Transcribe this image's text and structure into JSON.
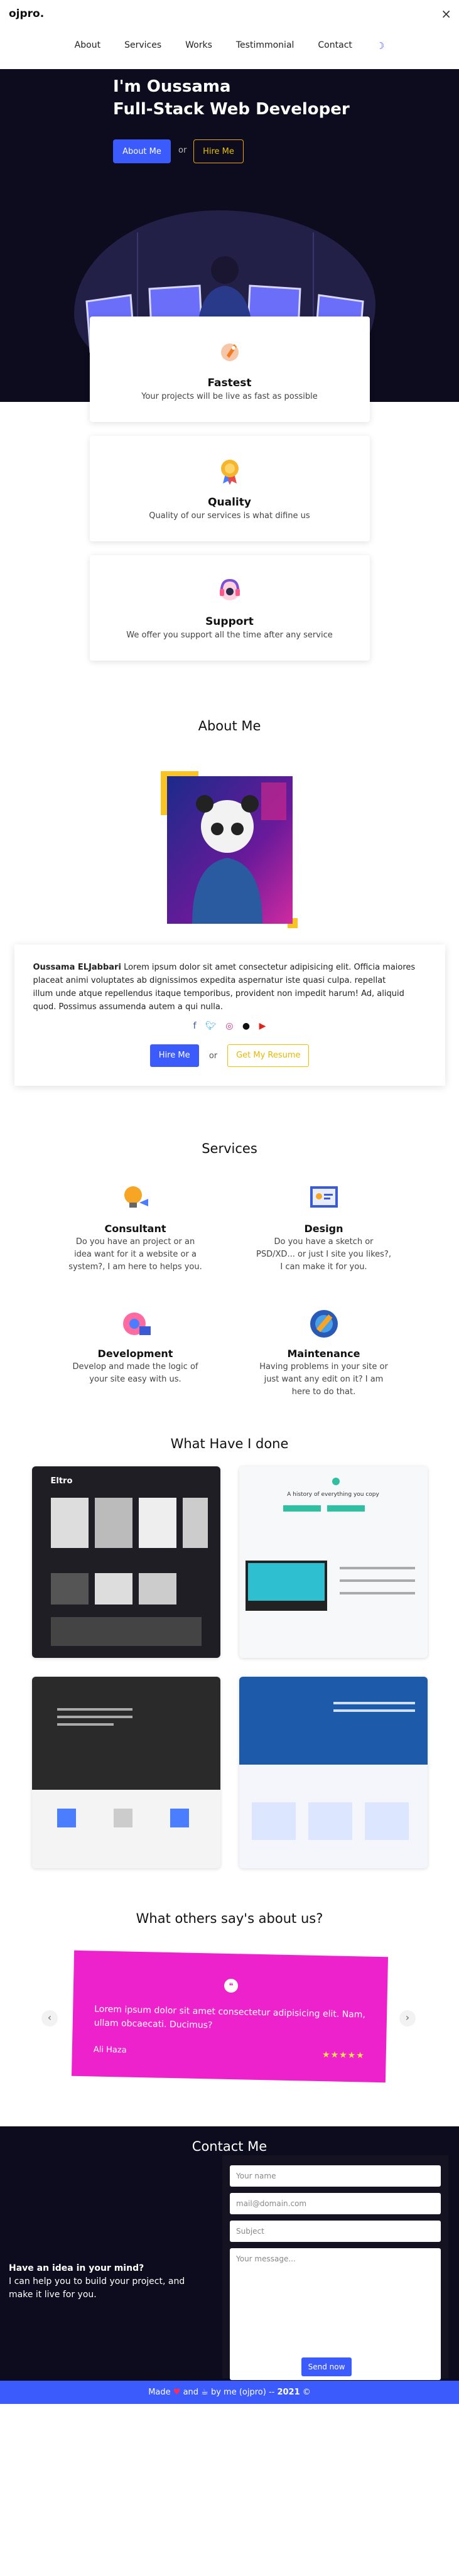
{
  "nav": {
    "logo": "ojpro.",
    "close_icon": "×",
    "items": [
      "About",
      "Services",
      "Works",
      "Testimmonial",
      "Contact"
    ],
    "theme_toggle": "☽"
  },
  "hero": {
    "line1": "I'm Oussama",
    "line2": "Full-Stack Web Developer",
    "about_button": "About Me",
    "or": "or",
    "hire_button": "Hire Me"
  },
  "features": [
    {
      "title": "Fastest",
      "text": "Your projects will be live as fast as possible",
      "icon": "rocket-icon"
    },
    {
      "title": "Quality",
      "text": "Quality of our services is what difine us",
      "icon": "medal-icon"
    },
    {
      "title": "Support",
      "text": "We offer you support all the time after any service",
      "icon": "headset-icon"
    }
  ],
  "about": {
    "title": "About Me",
    "name": "Oussama ELJabbari",
    "text1": "Lorem ipsum dolor sit amet consectetur adipisicing elit. Officia maiores placeat animi voluptates ab dignissimos expedita aspernatur iste quasi culpa. repellat",
    "text2": "illum unde atque repellendus itaque temporibus, provident non impedit harum! Ad, aliquid quod. Possimus assumenda autem a qui nulla.",
    "social_icons": [
      "facebook-icon",
      "twitter-icon",
      "instagram-icon",
      "github-icon",
      "youtube-icon"
    ],
    "hire_button": "Hire Me",
    "or": "or",
    "resume_button": "Get My Resume"
  },
  "services": {
    "title": "Services",
    "items": [
      {
        "title": "Consultant",
        "text": "Do you have an project or an idea want for it a website or a system?, I am here to helps you."
      },
      {
        "title": "Design",
        "text": "Do you have a sketch or PSD/XD... or just I site you likes?, I can make it for you."
      },
      {
        "title": "Development",
        "text": "Develop and made the logic of your site easy with us."
      },
      {
        "title": "Maintenance",
        "text": "Having problems in your site or just want any edit on it? I am here to do that."
      }
    ]
  },
  "work": {
    "title": "What Have I done",
    "shot1_brand": "Eltro",
    "shot2_heading": "A history of everything you copy"
  },
  "testimonials": {
    "title": "What others say's about us?",
    "quote": "Lorem ipsum dolor sit amet consectetur adipisicing elit. Nam, ullam obcaecati. Ducimus?",
    "name": "Ali Haza",
    "stars": "★★★★★",
    "prev": "‹",
    "next": "›"
  },
  "contact": {
    "title": "Contact Me",
    "pitch_title": "Have an idea in your mind?",
    "pitch_text": "I can help you to build your project, and make it live for you.",
    "name_placeholder": "Your name",
    "email_placeholder": "mail@domain.com",
    "subject_placeholder": "Subject",
    "message_placeholder": "Your message...",
    "send_button": "Send now"
  },
  "footer": {
    "made": "Made",
    "and": "and",
    "by": "by me (ojpro) --",
    "year": "2021",
    "copyright": "©"
  }
}
